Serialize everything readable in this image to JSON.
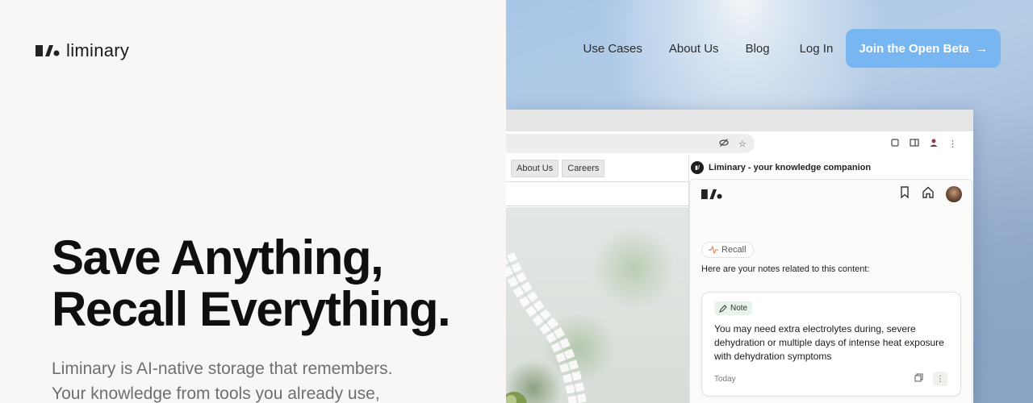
{
  "brand": {
    "name": "liminary"
  },
  "nav": {
    "links": [
      "Use Cases",
      "About Us",
      "Blog"
    ],
    "login": "Log In",
    "cta": "Join the Open Beta",
    "cta_icon": "arrow-right-icon"
  },
  "hero": {
    "line1": "Save Anything,",
    "line2": "Recall Everything.",
    "sub_line1": "Liminary is AI-native storage that remembers.",
    "sub_line2": "Your knowledge from tools you already use,"
  },
  "browser": {
    "page_tabs": [
      "About Us",
      "Careers"
    ],
    "sidebar_title": "Liminary - your knowledge companion",
    "recall_label": "Recall",
    "recall_intro": "Here are your notes related to this content:",
    "note": {
      "label": "Note",
      "body": "You may need extra electrolytes during, severe dehydration or multiple days of intense heat exposure with dehydration symptoms",
      "date": "Today"
    }
  },
  "colors": {
    "cta_bg": "#78b6f1",
    "hero_text": "#0f0f0f",
    "subtext": "#6f6f6f",
    "left_bg": "#f8f7f5"
  }
}
